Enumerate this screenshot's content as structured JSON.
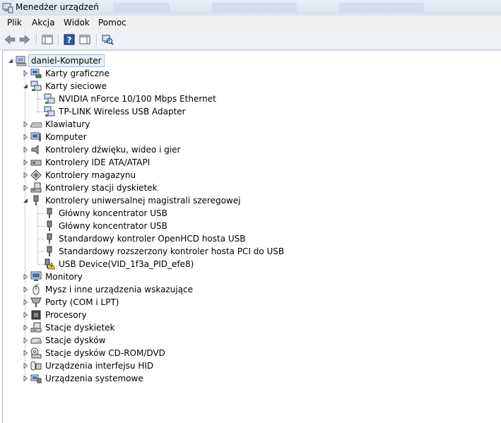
{
  "window": {
    "title": "Menedżer urządzeń"
  },
  "menu": [
    "Plik",
    "Akcja",
    "Widok",
    "Pomoc"
  ],
  "toolbar": [
    "back-icon",
    "forward-icon",
    "properties-pane-icon",
    "help-icon",
    "console-tree-icon",
    "scan-hardware-icon"
  ],
  "tree": {
    "root": "daniel-Komputer",
    "categories": [
      {
        "label": "Karty graficzne",
        "icon": "display-adapter-icon",
        "expanded": false
      },
      {
        "label": "Karty sieciowe",
        "icon": "network-adapter-icon",
        "expanded": true,
        "children": [
          {
            "label": "NVIDIA nForce 10/100 Mbps Ethernet",
            "icon": "network-adapter-icon"
          },
          {
            "label": "TP-LINK Wireless USB Adapter",
            "icon": "network-adapter-icon"
          }
        ]
      },
      {
        "label": "Klawiatury",
        "icon": "keyboard-icon",
        "expanded": false
      },
      {
        "label": "Komputer",
        "icon": "computer-icon",
        "expanded": false
      },
      {
        "label": "Kontrolery dźwięku, wideo i gier",
        "icon": "speaker-icon",
        "expanded": false
      },
      {
        "label": "Kontrolery IDE ATA/ATAPI",
        "icon": "ide-controller-icon",
        "expanded": false
      },
      {
        "label": "Kontrolery magazynu",
        "icon": "storage-controller-icon",
        "expanded": false
      },
      {
        "label": "Kontrolery stacji dyskietek",
        "icon": "floppy-controller-icon",
        "expanded": false
      },
      {
        "label": "Kontrolery uniwersalnej magistrali szeregowej",
        "icon": "usb-icon",
        "expanded": true,
        "children": [
          {
            "label": "Główny koncentrator USB",
            "icon": "usb-icon"
          },
          {
            "label": "Główny koncentrator USB",
            "icon": "usb-icon"
          },
          {
            "label": "Standardowy kontroler OpenHCD hosta USB",
            "icon": "usb-icon"
          },
          {
            "label": "Standardowy rozszerzony kontroler hosta PCI do USB",
            "icon": "usb-icon"
          },
          {
            "label": "USB Device(VID_1f3a_PID_efe8)",
            "icon": "usb-warning-icon"
          }
        ]
      },
      {
        "label": "Monitory",
        "icon": "monitor-icon",
        "expanded": false
      },
      {
        "label": "Mysz i inne urządzenia wskazujące",
        "icon": "mouse-icon",
        "expanded": false
      },
      {
        "label": "Porty (COM i LPT)",
        "icon": "port-icon",
        "expanded": false
      },
      {
        "label": "Procesory",
        "icon": "processor-icon",
        "expanded": false
      },
      {
        "label": "Stacje dyskietek",
        "icon": "floppy-drive-icon",
        "expanded": false
      },
      {
        "label": "Stacje dysków",
        "icon": "disk-drive-icon",
        "expanded": false
      },
      {
        "label": "Stacje dysków CD-ROM/DVD",
        "icon": "cdrom-icon",
        "expanded": false
      },
      {
        "label": "Urządzenia interfejsu HID",
        "icon": "hid-icon",
        "expanded": false
      },
      {
        "label": "Urządzenia systemowe",
        "icon": "system-devices-icon",
        "expanded": false
      }
    ]
  }
}
